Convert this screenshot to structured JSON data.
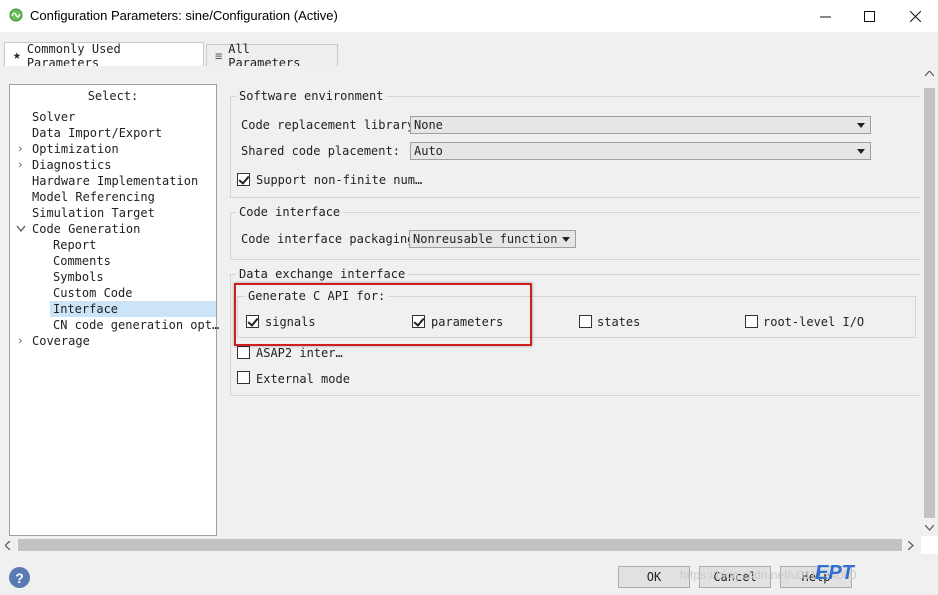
{
  "window": {
    "title": "Configuration Parameters: sine/Configuration (Active)",
    "minimize": "—",
    "maximize": "☐",
    "close": "✕"
  },
  "tabs": [
    {
      "icon": "★",
      "label": "Commonly Used Parameters"
    },
    {
      "icon": "≡",
      "label": "All Parameters"
    }
  ],
  "nav": {
    "header": "Select:",
    "items": [
      "Solver",
      "Data Import/Export",
      "Optimization",
      "Diagnostics",
      "Hardware Implementation",
      "Model Referencing",
      "Simulation Target",
      "Code Generation",
      "Report",
      "Comments",
      "Symbols",
      "Custom Code",
      "Interface",
      "CN code generation opt…",
      "Coverage"
    ]
  },
  "software_env": {
    "legend": "Software environment",
    "code_repl_label": "Code replacement library:",
    "code_repl_value": "None",
    "shared_code_label": "Shared code placement:",
    "shared_code_value": "Auto",
    "nonfinite_label": "Support non-finite num…"
  },
  "code_interface": {
    "legend": "Code interface",
    "packaging_label": "Code interface packaging:",
    "packaging_value": "Nonreusable function"
  },
  "data_exchange": {
    "legend": "Data exchange interface",
    "capi_legend": "Generate C API for:",
    "signals": "signals",
    "parameters": "parameters",
    "states": "states",
    "root_io": "root-level I/O",
    "asap2": "ASAP2 inter…",
    "external_mode": "External mode"
  },
  "buttons": {
    "ok": "OK",
    "cancel": "Cancel",
    "help": "Help",
    "help_icon": "?"
  },
  "watermark": {
    "url": "https://blog.csdn.net/u011734080",
    "logo": "EPT"
  }
}
